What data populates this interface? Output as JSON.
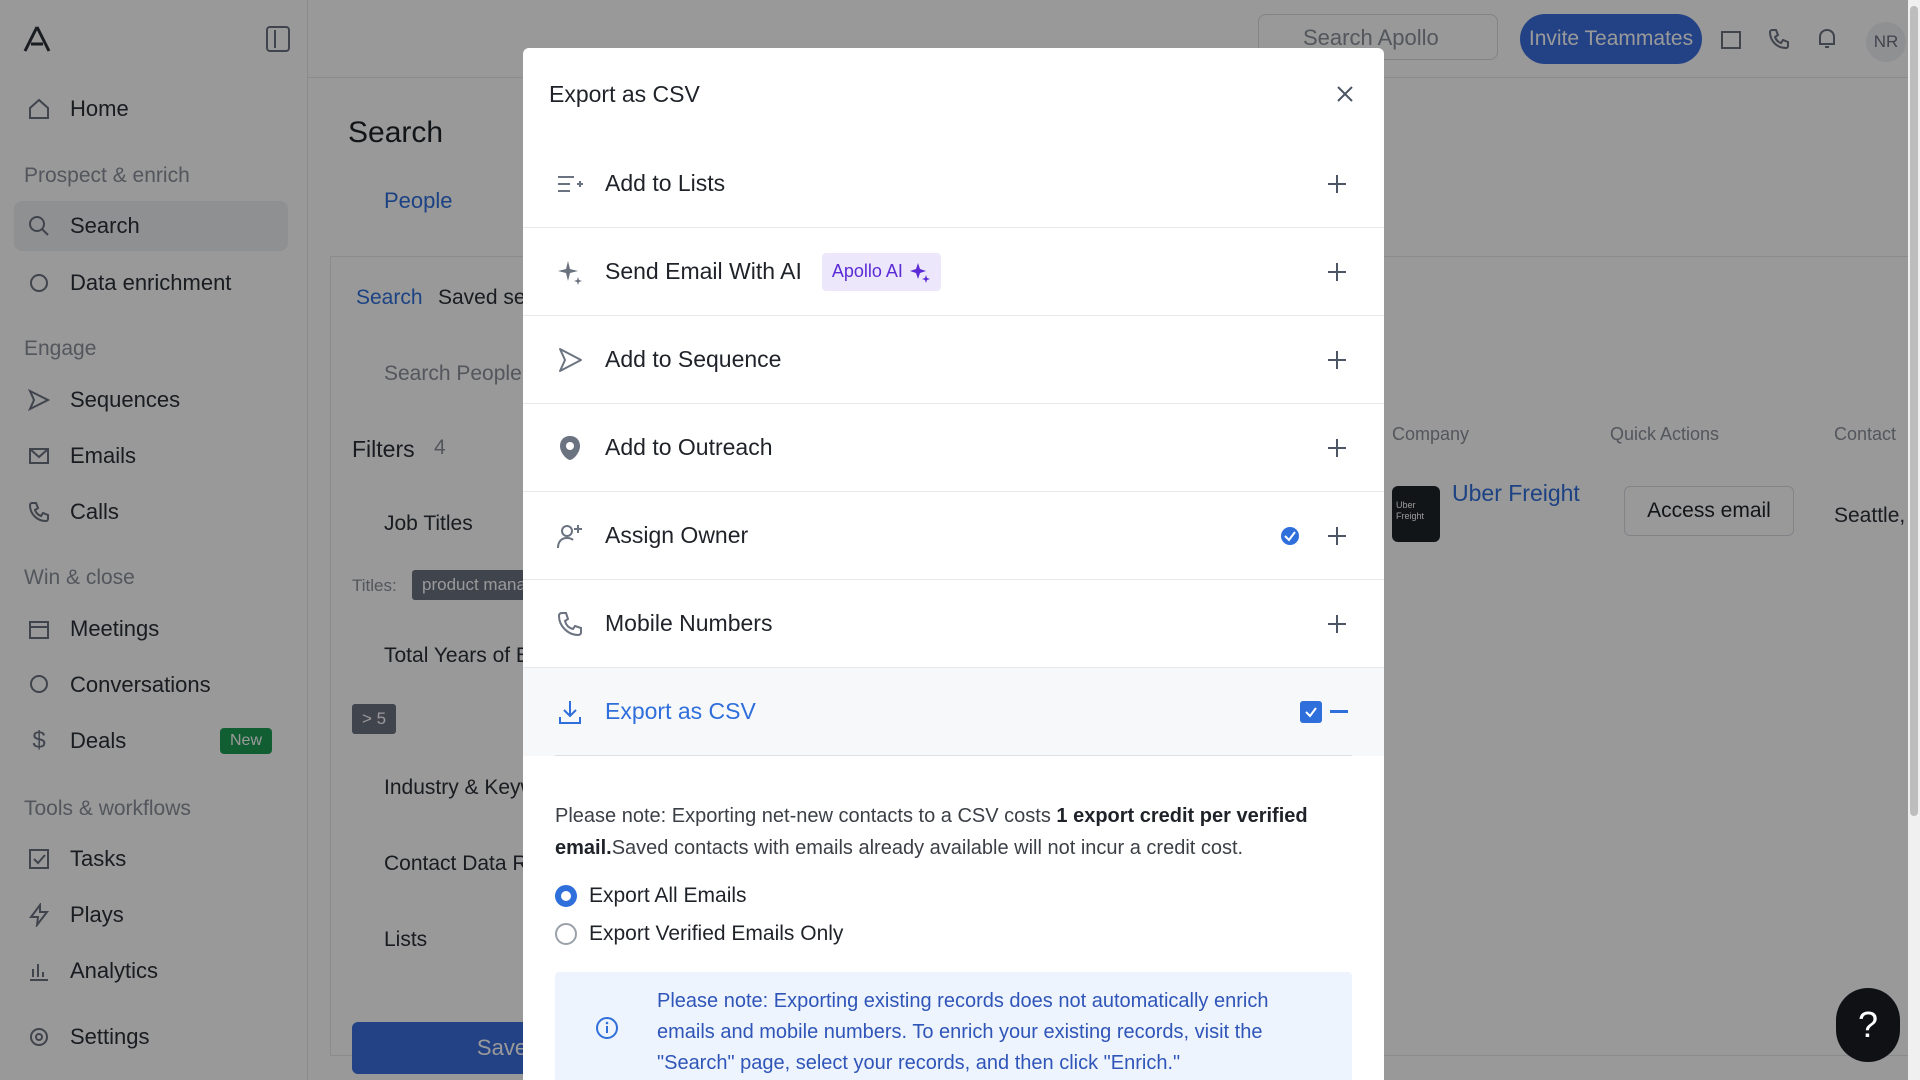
{
  "sidebar": {
    "items": {
      "home": "Home",
      "search": "Search",
      "data_enrichment": "Data enrichment",
      "sequences": "Sequences",
      "emails": "Emails",
      "calls": "Calls",
      "meetings": "Meetings",
      "conversations": "Conversations",
      "deals": "Deals",
      "tasks": "Tasks",
      "plays": "Plays",
      "analytics": "Analytics",
      "settings": "Settings"
    },
    "sections": {
      "prospect": "Prospect & enrich",
      "engage": "Engage",
      "win": "Win & close",
      "tools": "Tools & workflows"
    },
    "new_badge": "New"
  },
  "topbar": {
    "search_placeholder": "Search Apollo",
    "invite_label": "Invite Teammates",
    "avatar_initials": "NR"
  },
  "main": {
    "title": "Search",
    "tab_people": "People",
    "subtab_search": "Search",
    "subtab_saved": "Saved sea",
    "search_people_placeholder": "Search People...",
    "filters_label": "Filters",
    "filters_count": "4",
    "job_titles": "Job Titles",
    "titles_label": "Titles:",
    "titles_chip": "product mana",
    "years_exp": "Total Years of Ex",
    "years_chip": "> 5",
    "industry": "Industry & Keyw",
    "contact_data": "Contact Data Re",
    "lists": "Lists",
    "save_button": "Save",
    "col_company": "Company",
    "col_quick_actions": "Quick Actions",
    "col_contact": "Contact",
    "company_name": "Uber Freight",
    "company_logo_text": "Uber Freight",
    "access_email": "Access email",
    "location": "Seattle,"
  },
  "modal": {
    "title": "Export as CSV",
    "options": [
      {
        "label": "Add to Lists"
      },
      {
        "label": "Send Email With AI",
        "badge": "Apollo AI"
      },
      {
        "label": "Add to Sequence"
      },
      {
        "label": "Add to Outreach"
      },
      {
        "label": "Assign Owner"
      },
      {
        "label": "Mobile Numbers"
      }
    ],
    "export": {
      "label": "Export as CSV",
      "note_pre": "Please note: Exporting net-new contacts to a CSV costs ",
      "note_bold": "1 export credit per verified email.",
      "note_post": "Saved contacts with emails already available will not incur a credit cost.",
      "radio_all": "Export All Emails",
      "radio_verified": "Export Verified Emails Only",
      "selected": "Export All Emails",
      "info": "Please note: Exporting existing records does not automatically enrich emails and mobile numbers. To enrich your existing records, visit the \"Search\" page, select your records, and then click \"Enrich.\""
    }
  },
  "help_label": "?",
  "colors": {
    "accent": "#2f6fdb",
    "ai_badge_bg": "#ede7fb",
    "ai_badge_text": "#5b2bd6",
    "info_bg": "#eef4fd"
  }
}
